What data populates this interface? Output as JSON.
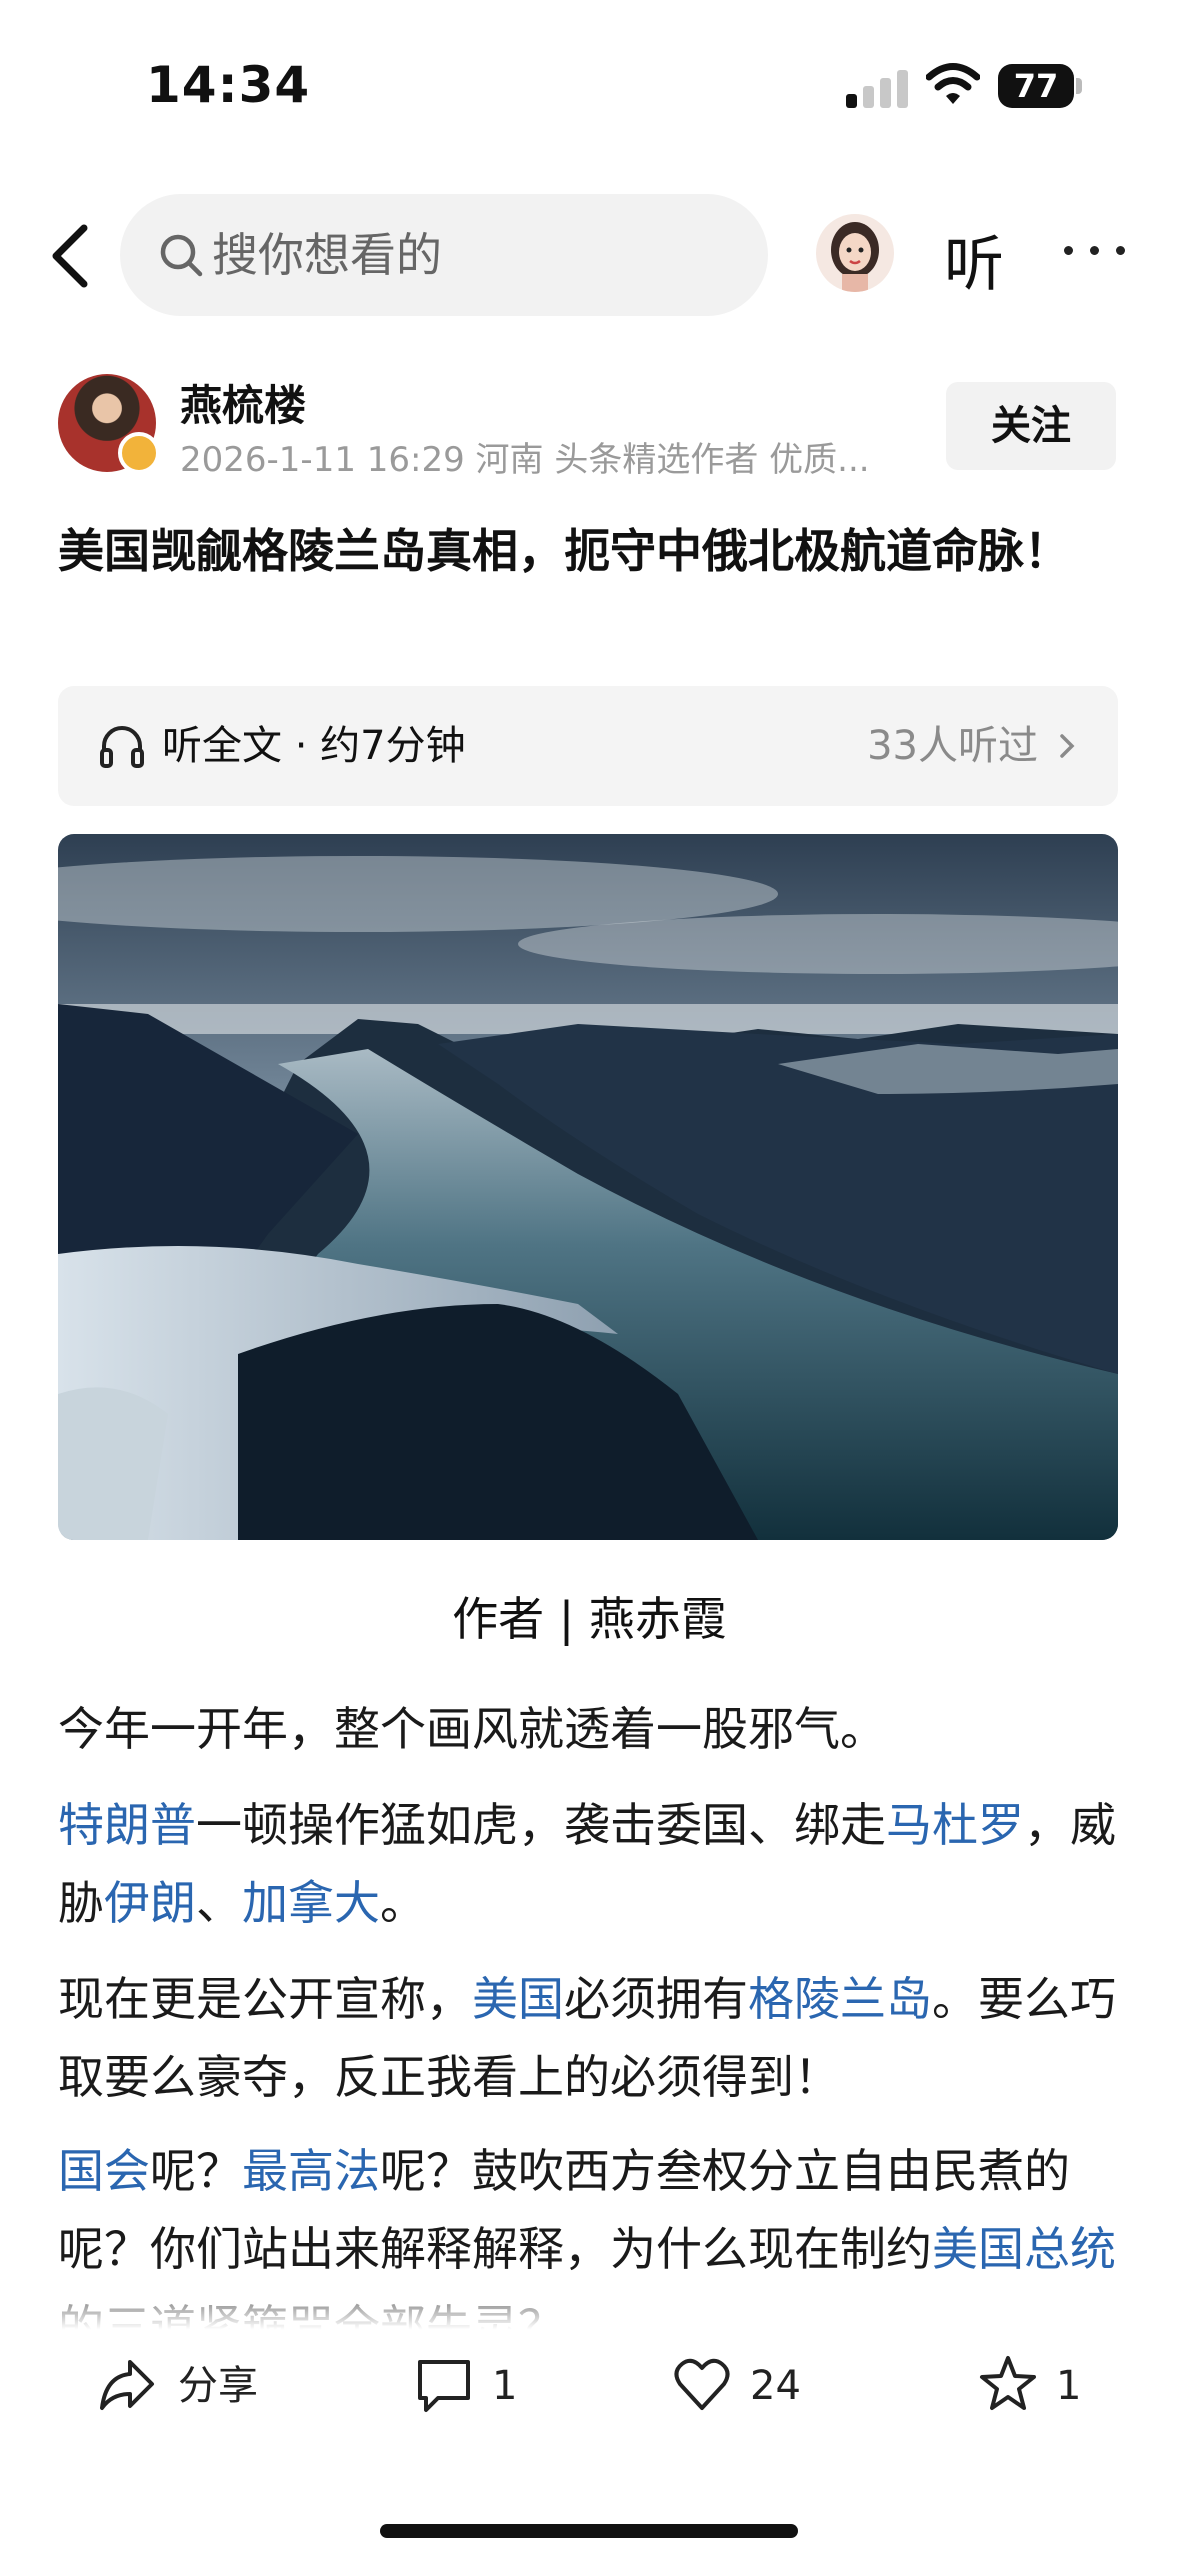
{
  "status_bar": {
    "time": "14:34",
    "battery": "77",
    "icons": [
      "signal-icon",
      "wifi-icon",
      "battery-icon"
    ]
  },
  "nav": {
    "back_icon": "chevron-left-icon",
    "search_placeholder": "搜你想看的",
    "search_icon": "search-icon",
    "listen_label": "听",
    "more_icon": "more-dots-icon"
  },
  "author": {
    "name": "燕梳楼",
    "meta": "2026-1-11  16:29  河南  头条精选作者  优质...",
    "follow_label": "关注"
  },
  "article": {
    "title": "美国觊觎格陵兰岛真相，扼守中俄北极航道命脉！",
    "listen_bar": {
      "label": "听全文 · 约7分钟",
      "count": "33人听过"
    },
    "image_alt": "fjord mountains landscape",
    "byline": "作者 | 燕赤霞",
    "paragraphs": [
      [
        {
          "t": "今年一开年，整个画风就透着一股邪气。"
        }
      ],
      [
        {
          "t": "特朗普",
          "link": true
        },
        {
          "t": "一顿操作猛如虎，袭击委国、绑走"
        },
        {
          "t": "马杜罗",
          "link": true
        },
        {
          "t": "，威胁"
        },
        {
          "t": "伊朗",
          "link": true
        },
        {
          "t": "、"
        },
        {
          "t": "加拿大",
          "link": true
        },
        {
          "t": "。"
        }
      ],
      [
        {
          "t": "现在更是公开宣称，"
        },
        {
          "t": "美国",
          "link": true
        },
        {
          "t": "必须拥有"
        },
        {
          "t": "格陵兰岛",
          "link": true
        },
        {
          "t": "。要么巧取要么豪夺，反正我看上的必须得到！"
        }
      ],
      [
        {
          "t": "国会",
          "link": true
        },
        {
          "t": "呢？"
        },
        {
          "t": "最高法",
          "link": true
        },
        {
          "t": "呢？鼓吹西方叁权分立自由民煮的呢？你们站出来解释解释，为什么现在制约"
        },
        {
          "t": "美国总统",
          "link": true
        },
        {
          "t": "的三道紧箍咒全部失灵？"
        }
      ]
    ]
  },
  "actions": {
    "share_label": "分享",
    "comments": "1",
    "likes": "24",
    "favorites": "1"
  },
  "colors": {
    "link": "#2a66b0",
    "muted": "#9a9a9a",
    "surface": "#f2f2f2"
  }
}
